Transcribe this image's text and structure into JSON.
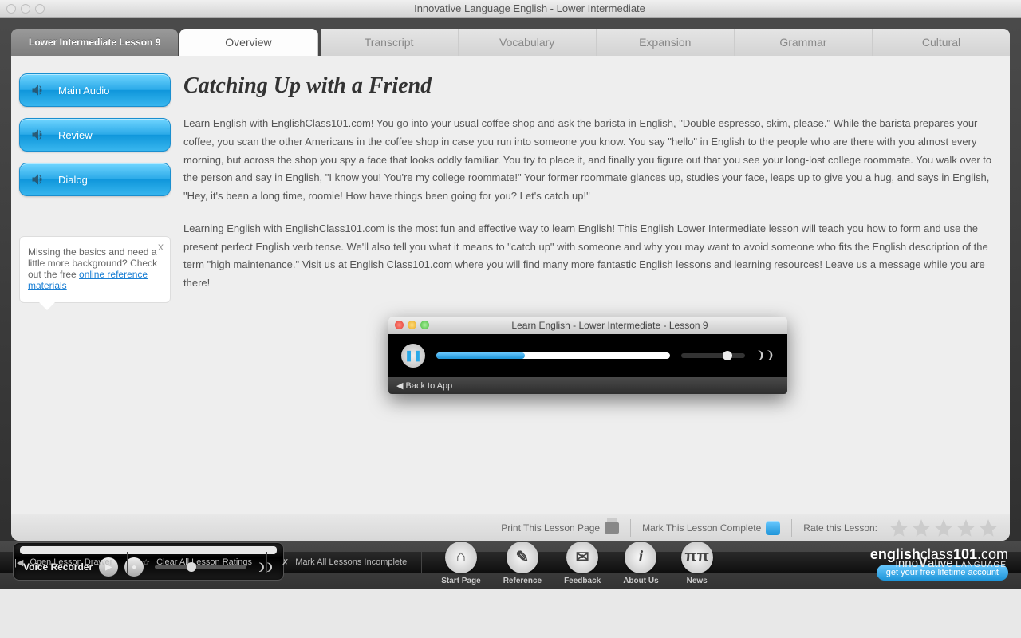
{
  "window": {
    "title": "Innovative Language English - Lower Intermediate"
  },
  "lesson_tab": "Lower Intermediate Lesson 9",
  "tabs": [
    "Overview",
    "Transcript",
    "Vocabulary",
    "Expansion",
    "Grammar",
    "Cultural"
  ],
  "sidebar": {
    "buttons": [
      "Main Audio",
      "Review",
      "Dialog"
    ],
    "help": {
      "text": "Missing the basics and need a little more background? Check out the free ",
      "link": "online reference materials",
      "close": "x"
    }
  },
  "content": {
    "title": "Catching Up with a Friend",
    "p1": "Learn English with EnglishClass101.com! You go into your usual coffee shop and ask the barista in English, \"Double espresso, skim, please.\" While the barista prepares your coffee, you scan the other Americans in the coffee shop in case you run into someone you know. You say \"hello\" in English to the people who are there with you almost every morning, but across the shop you spy a face that looks oddly familiar. You try to place it, and finally you figure out that you see your long-lost college roommate. You walk over to the person and say in English, \"I know you! You're my college roommate!\" Your former roommate glances up, studies your face, leaps up to give you a hug, and says in English, \"Hey, it's been a long time, roomie! How have things been going for you? Let's catch up!\"",
    "p2": "Learning English with EnglishClass101.com is the most fun and effective way to learn English! This English Lower Intermediate lesson will teach you how to form and use the present perfect English verb tense. We'll also tell you what it means to \"catch up\" with someone and why you may want to avoid someone who fits the English description of the term \"high maintenance.\" Visit us at English Class101.com where you will find many more fantastic English lessons and learning resources! Leave us a message while you are there!"
  },
  "player": {
    "title": "Learn English - Lower Intermediate - Lesson 9",
    "back": "◀ Back to App"
  },
  "panel_footer": {
    "print": "Print This Lesson Page",
    "mark": "Mark This Lesson Complete",
    "rate": "Rate this Lesson:"
  },
  "recorder": {
    "label": "Voice Recorder"
  },
  "nav": [
    {
      "label": "Start Page",
      "icon": "home"
    },
    {
      "label": "Reference",
      "icon": "pen"
    },
    {
      "label": "Feedback",
      "icon": "chat"
    },
    {
      "label": "About Us",
      "icon": "info"
    },
    {
      "label": "News",
      "icon": "rss"
    }
  ],
  "promo": {
    "site": "englishclass101.com",
    "cta": "get your free lifetime account"
  },
  "status": {
    "s1": "Open Lesson Drawer",
    "s2": "Clear All Lesson Ratings",
    "s3": "Mark All Lessons Incomplete",
    "brand_a": "inno",
    "brand_b": "V",
    "brand_c": "ative",
    "brand_d": " LANGUAGE"
  }
}
